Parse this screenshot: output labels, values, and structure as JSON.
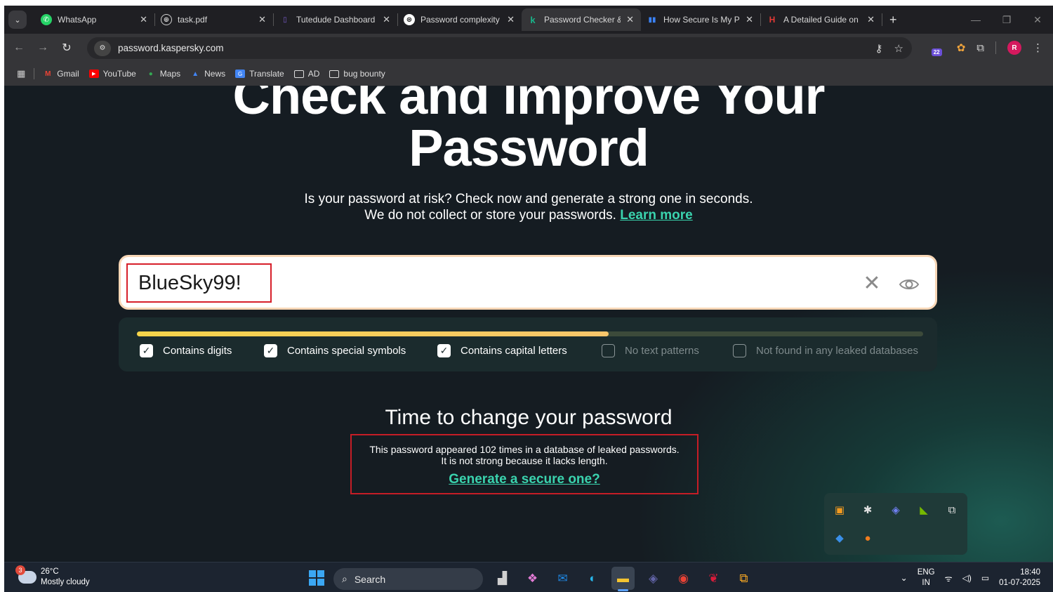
{
  "browser": {
    "tabs": [
      {
        "label": "WhatsApp",
        "icon": "whatsapp-icon",
        "color": "#25d366"
      },
      {
        "label": "task.pdf",
        "icon": "globe-icon",
        "color": "#cfcfcf"
      },
      {
        "label": "Tutedude Dashboard",
        "icon": "book-icon",
        "color": "#7a5ccc"
      },
      {
        "label": "Password complexity",
        "icon": "chatgpt-icon",
        "color": "#ffffff"
      },
      {
        "label": "Password Checker &",
        "icon": "kaspersky-icon",
        "color": "#19b58a",
        "active": true
      },
      {
        "label": "How Secure Is My Pa",
        "icon": "bars-icon",
        "color": "#3b82f6"
      },
      {
        "label": "A Detailed Guide on",
        "icon": "h-icon",
        "color": "#e53935"
      }
    ],
    "url": "password.kaspersky.com",
    "extension_badge": "22",
    "profile_initial": "R",
    "bookmarks": [
      {
        "label": "Gmail",
        "icon": "gmail-icon"
      },
      {
        "label": "YouTube",
        "icon": "youtube-icon"
      },
      {
        "label": "Maps",
        "icon": "maps-icon"
      },
      {
        "label": "News",
        "icon": "news-icon"
      },
      {
        "label": "Translate",
        "icon": "translate-icon"
      },
      {
        "label": "AD",
        "icon": "folder-icon"
      },
      {
        "label": "bug bounty",
        "icon": "folder-icon"
      }
    ]
  },
  "page": {
    "title_line1": "Check and Improve Your",
    "title_line2": "Password",
    "sub_line1": "Is your password at risk? Check now and generate a strong one in seconds.",
    "sub_line2": "We do not collect or store your passwords.",
    "learn_more": "Learn more",
    "password_value": "BlueSky99!",
    "strength_fraction": 0.6,
    "criteria": [
      {
        "label": "Contains digits",
        "checked": true
      },
      {
        "label": "Contains special symbols",
        "checked": true
      },
      {
        "label": "Contains capital letters",
        "checked": true
      },
      {
        "label": "No text patterns",
        "checked": false
      },
      {
        "label": "Not found in any leaked databases",
        "checked": false
      }
    ],
    "verdict": "Time to change your password",
    "warning_line1": "This password appeared 102 times in a database of leaked passwords.",
    "warning_line2": "It is not strong because it lacks length.",
    "generate_link": "Generate a secure one?"
  },
  "taskbar": {
    "weather_badge": "3",
    "temperature": "26°C",
    "condition": "Mostly cloudy",
    "search_label": "Search",
    "lang_line1": "ENG",
    "lang_line2": "IN",
    "time": "18:40",
    "date": "01-07-2025"
  },
  "colors": {
    "accent": "#3ad3ae",
    "page_bg": "#151c22",
    "highlight_red": "#d71f2a",
    "strength_bar": "#f6d44a"
  }
}
